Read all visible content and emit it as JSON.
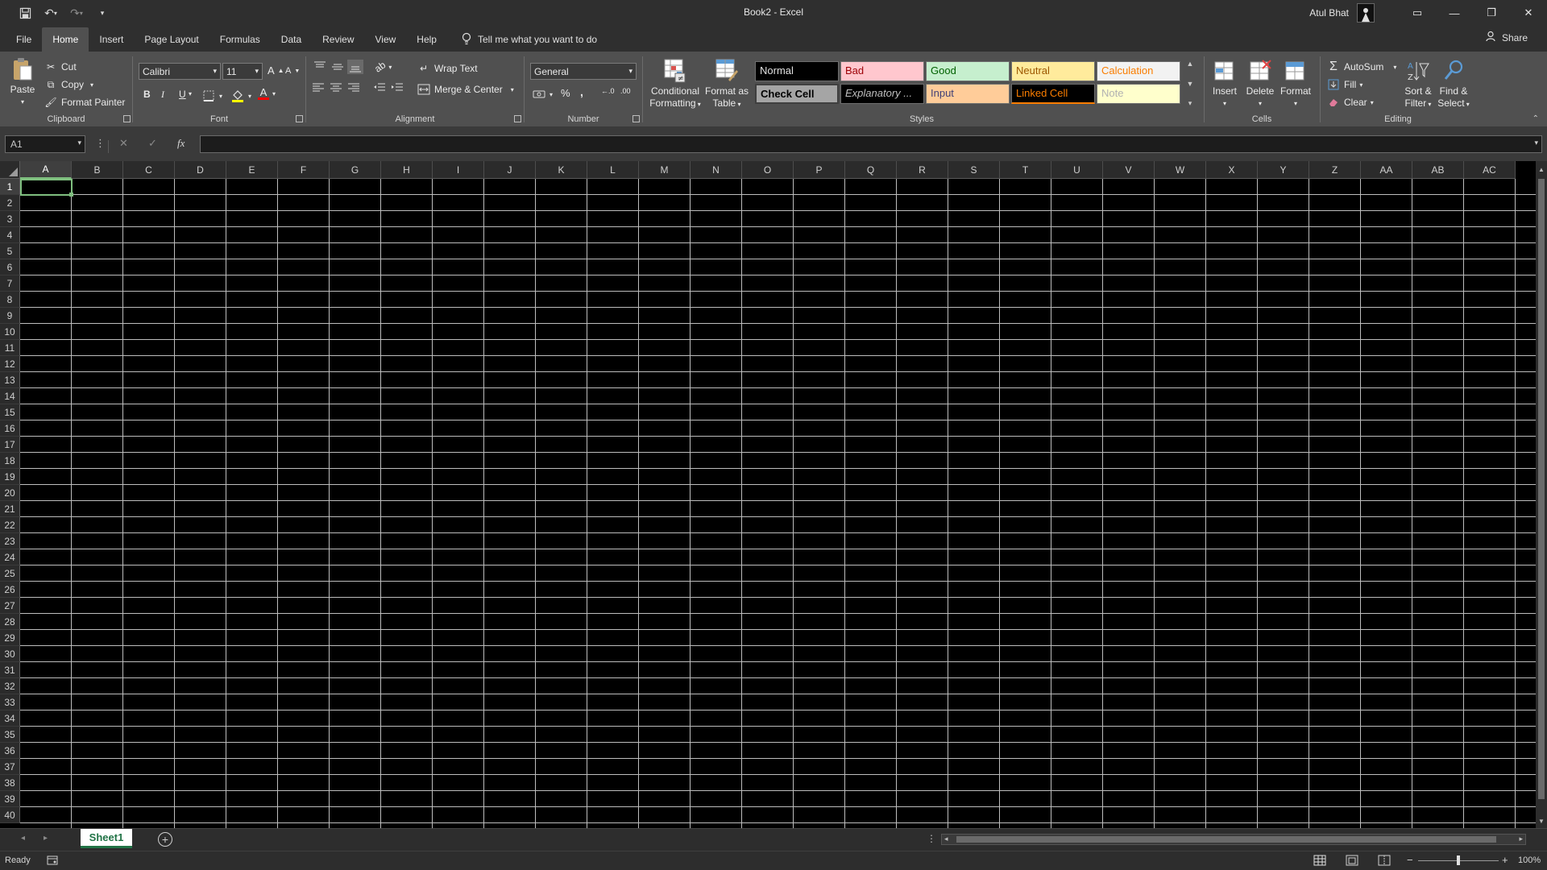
{
  "window": {
    "title": "Book2  -  Excel",
    "user_name": "Atul Bhat",
    "minimize_glyph": "—",
    "restore_glyph": "❐",
    "close_glyph": "✕",
    "ribbon_display_glyph": "▭"
  },
  "qat": {
    "save_icon": "save-icon",
    "undo_icon": "undo-icon",
    "redo_icon": "redo-icon",
    "customize_icon": "customize-qat-icon"
  },
  "tabs": [
    "File",
    "Home",
    "Insert",
    "Page Layout",
    "Formulas",
    "Data",
    "Review",
    "View",
    "Help"
  ],
  "active_tab": "Home",
  "tell_me": "Tell me what you want to do",
  "share_label": "Share",
  "clipboard": {
    "paste": "Paste",
    "cut": "Cut",
    "copy": "Copy",
    "format_painter": "Format Painter",
    "label": "Clipboard"
  },
  "font": {
    "family": "Calibri",
    "size": "11",
    "bold": "B",
    "italic": "I",
    "underline": "U",
    "grow": "A",
    "shrink": "A",
    "font_color": "A",
    "label": "Font"
  },
  "alignment": {
    "wrap_text": "Wrap Text",
    "merge_center": "Merge & Center",
    "label": "Alignment"
  },
  "number": {
    "format": "General",
    "percent": "%",
    "comma": ",",
    "inc_decimal": "←.0",
    "dec_decimal": ".00",
    "label": "Number"
  },
  "styles_group": {
    "conditional_formatting_1": "Conditional",
    "conditional_formatting_2": "Formatting",
    "format_as_table_1": "Format as",
    "format_as_table_2": "Table",
    "label": "Styles",
    "cells": [
      {
        "text": "Normal",
        "bg": "#000000",
        "fg": "#e0e0e0"
      },
      {
        "text": "Bad",
        "bg": "#ffc7ce",
        "fg": "#9c0006"
      },
      {
        "text": "Good",
        "bg": "#c6efce",
        "fg": "#006100"
      },
      {
        "text": "Neutral",
        "bg": "#ffeb9c",
        "fg": "#9c5700"
      },
      {
        "text": "Calculation",
        "bg": "#f2f2f2",
        "fg": "#fa7d00"
      },
      {
        "text": "Check Cell",
        "bg": "#a5a5a5",
        "fg": "#000000"
      },
      {
        "text": "Explanatory ...",
        "bg": "#000000",
        "fg": "#bfbfbf"
      },
      {
        "text": "Input",
        "bg": "#ffcc99",
        "fg": "#3f3f76"
      },
      {
        "text": "Linked Cell",
        "bg": "#000000",
        "fg": "#fa7d00"
      },
      {
        "text": "Note",
        "bg": "#ffffcc",
        "fg": "#b2b2b2"
      }
    ]
  },
  "cells_group": {
    "insert": "Insert",
    "delete": "Delete",
    "format": "Format",
    "label": "Cells"
  },
  "editing": {
    "autosum": "AutoSum",
    "fill": "Fill",
    "clear": "Clear",
    "sort_filter_1": "Sort &",
    "sort_filter_2": "Filter",
    "find_select_1": "Find &",
    "find_select_2": "Select",
    "label": "Editing"
  },
  "formula_bar": {
    "name_box": "A1",
    "cancel_glyph": "✕",
    "enter_glyph": "✓",
    "fx_glyph": "fx",
    "value": ""
  },
  "columns": [
    "A",
    "B",
    "C",
    "D",
    "E",
    "F",
    "G",
    "H",
    "I",
    "J",
    "K",
    "L",
    "M",
    "N",
    "O",
    "P",
    "Q",
    "R",
    "S",
    "T",
    "U",
    "V",
    "W",
    "X",
    "Y",
    "Z",
    "AA",
    "AB",
    "AC"
  ],
  "rows": [
    "1",
    "2",
    "3",
    "4",
    "5",
    "6",
    "7",
    "8",
    "9",
    "10",
    "11",
    "12",
    "13",
    "14",
    "15",
    "16",
    "17",
    "18",
    "19",
    "20",
    "21",
    "22",
    "23",
    "24",
    "25",
    "26",
    "27",
    "28",
    "29",
    "30",
    "31",
    "32",
    "33",
    "34",
    "35",
    "36",
    "37",
    "38",
    "39",
    "40"
  ],
  "selected_cell": {
    "col": "A",
    "row": "1"
  },
  "sheets": [
    "Sheet1"
  ],
  "status": {
    "ready": "Ready",
    "zoom": "100%"
  },
  "accent_color": "#217346",
  "selection_color": "#7fbf7f"
}
